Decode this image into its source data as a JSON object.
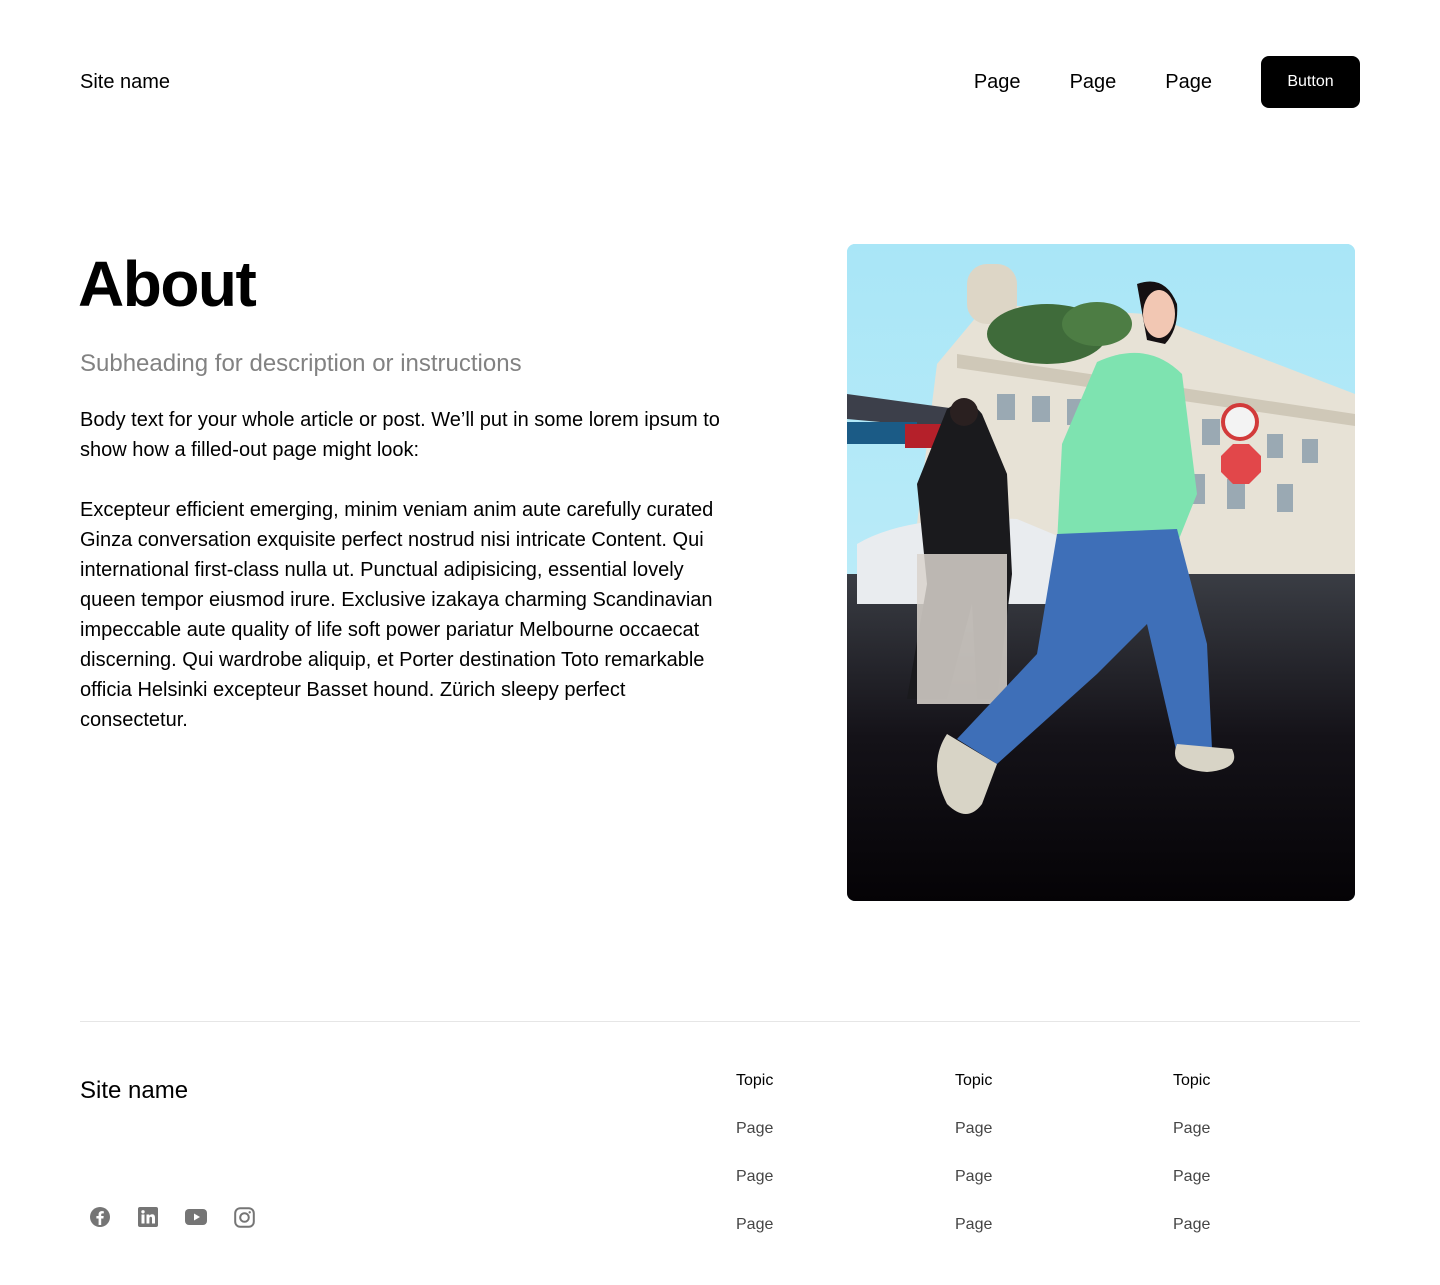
{
  "header": {
    "site_name": "Site name",
    "nav": [
      "Page",
      "Page",
      "Page"
    ],
    "button_label": "Button"
  },
  "main": {
    "title": "About",
    "subtitle": "Subheading for description or instructions",
    "paragraphs": [
      "Body text for your whole article or post. We’ll put in some lorem ipsum to show how a filled-out page might look:",
      "Excepteur efficient emerging, minim veniam anim aute carefully curated Ginza conversation exquisite perfect nostrud nisi intricate Content. Qui  international first-class nulla ut. Punctual adipisicing, essential lovely queen tempor eiusmod irure. Exclusive izakaya charming Scandinavian impeccable aute quality of life soft power pariatur Melbourne occaecat discerning. Qui wardrobe aliquip, et Porter destination Toto remarkable officia Helsinki excepteur Basset hound. Zürich sleepy perfect consectetur."
    ],
    "photo_icon": "street-photo-woman-walking"
  },
  "footer": {
    "site_name": "Site name",
    "social": [
      "facebook-icon",
      "linkedin-icon",
      "youtube-icon",
      "instagram-icon"
    ],
    "columns": [
      {
        "topic": "Topic",
        "links": [
          "Page",
          "Page",
          "Page"
        ]
      },
      {
        "topic": "Topic",
        "links": [
          "Page",
          "Page",
          "Page"
        ]
      },
      {
        "topic": "Topic",
        "links": [
          "Page",
          "Page",
          "Page"
        ]
      }
    ]
  },
  "colors": {
    "text": "#000000",
    "subtitle": "#828282",
    "footer_link": "#454545",
    "divider": "#e6e6e6",
    "button_bg": "#000000",
    "icon": "#757575"
  }
}
